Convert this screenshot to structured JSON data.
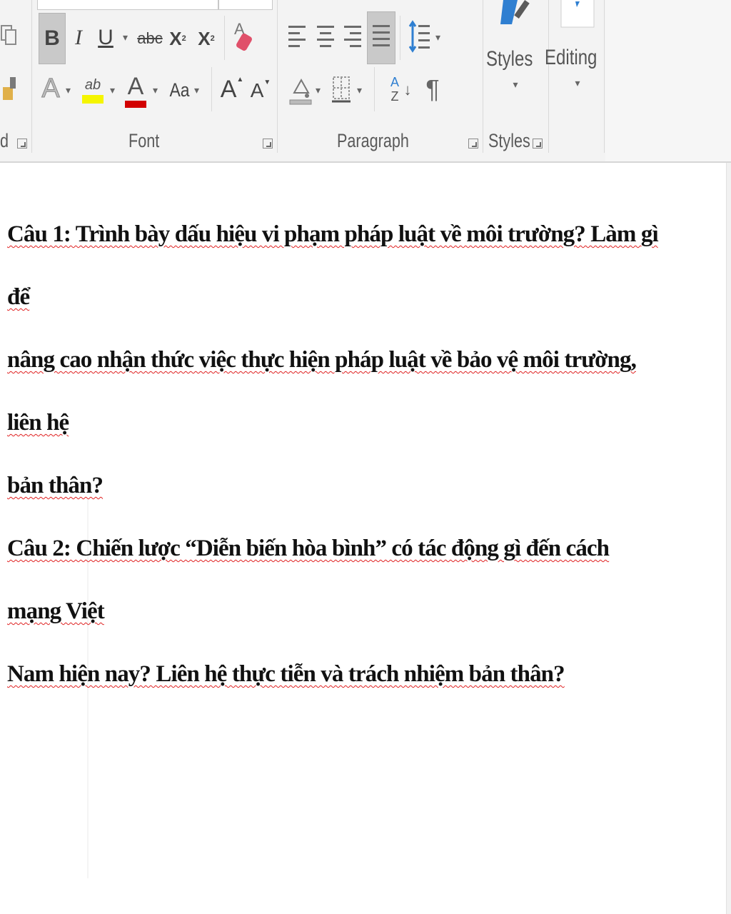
{
  "ribbon": {
    "groups": {
      "clipboard_label": "d",
      "font_label": "Font",
      "paragraph_label": "Paragraph",
      "styles_label": "Styles"
    },
    "font": {
      "bold": "B",
      "italic": "I",
      "underline": "U",
      "strikethrough": "abc",
      "subscript": "X",
      "subscript_mark": "2",
      "superscript": "X",
      "superscript_mark": "2",
      "text_effects": "A",
      "highlight": "ab",
      "font_color": "A",
      "change_case": "Aa",
      "grow_font": "A",
      "shrink_font": "A"
    },
    "paragraph": {
      "sort_a": "A",
      "sort_z": "Z",
      "pilcrow": "¶"
    },
    "styles_button": "Styles",
    "editing_button": "Editing",
    "colors": {
      "highlight": "#f5f500",
      "font_color": "#d20000",
      "styles_icon": "#2f7fd1"
    }
  },
  "document": {
    "paragraphs": [
      {
        "lines": [
          "Câu 1: Trình bày dấu hiệu vi phạm pháp luật về môi trường? Làm gì để",
          "nâng cao nhận thức việc thực hiện pháp luật về bảo vệ môi trường, liên hệ",
          "bản thân?"
        ]
      },
      {
        "lines": [
          "Câu 2: Chiến lược “Diễn biến hòa bình” có tác động gì đến cách mạng Việt",
          "Nam hiện nay? Liên hệ thực tiễn và trách nhiệm bản thân?"
        ]
      }
    ]
  }
}
